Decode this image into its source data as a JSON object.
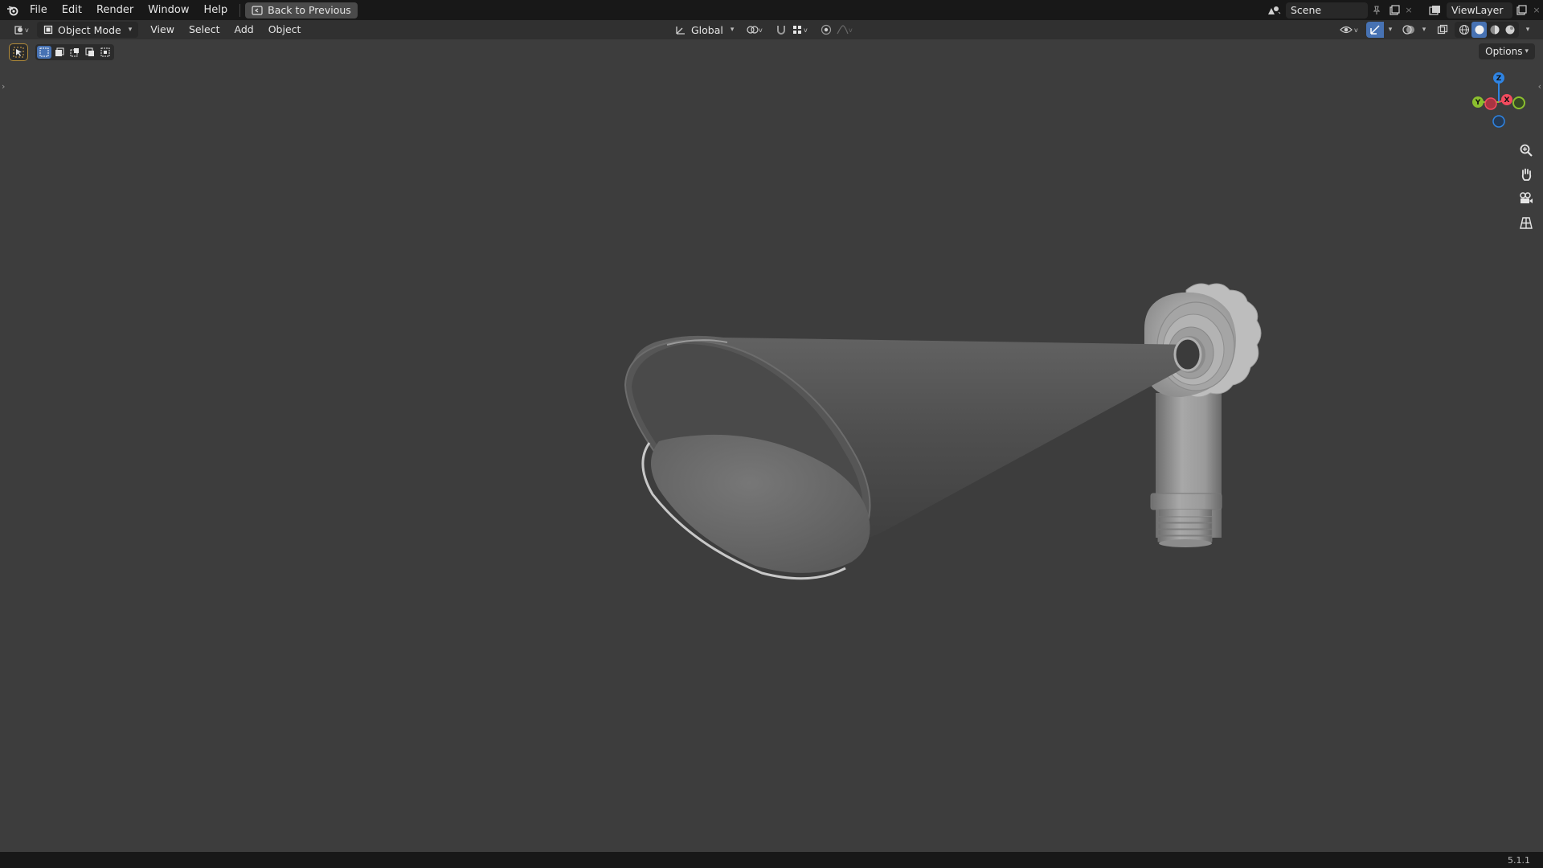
{
  "app": {
    "name": "Blender",
    "version": "5.1.1"
  },
  "topbar": {
    "menus": [
      "File",
      "Edit",
      "Render",
      "Window",
      "Help"
    ],
    "back_button": "Back to Previous",
    "scene": "Scene",
    "view_layer": "ViewLayer"
  },
  "header": {
    "mode": "Object Mode",
    "menus": [
      "View",
      "Select",
      "Add",
      "Object"
    ],
    "transform_orientation": "Global"
  },
  "viewport": {
    "options_label": "Options",
    "gizmo_axes": [
      "Z",
      "Y",
      "X"
    ],
    "nav_tools": [
      "zoom-icon",
      "hand-icon",
      "camera-icon",
      "grid-icon"
    ],
    "scene_object": "tapered-horn-with-valve-model"
  },
  "colors": {
    "accent": "#4772b3",
    "axis_x": "#f34b5e",
    "axis_y": "#8bbf2e",
    "axis_z": "#2f84e3",
    "background": "#3d3d3d"
  }
}
